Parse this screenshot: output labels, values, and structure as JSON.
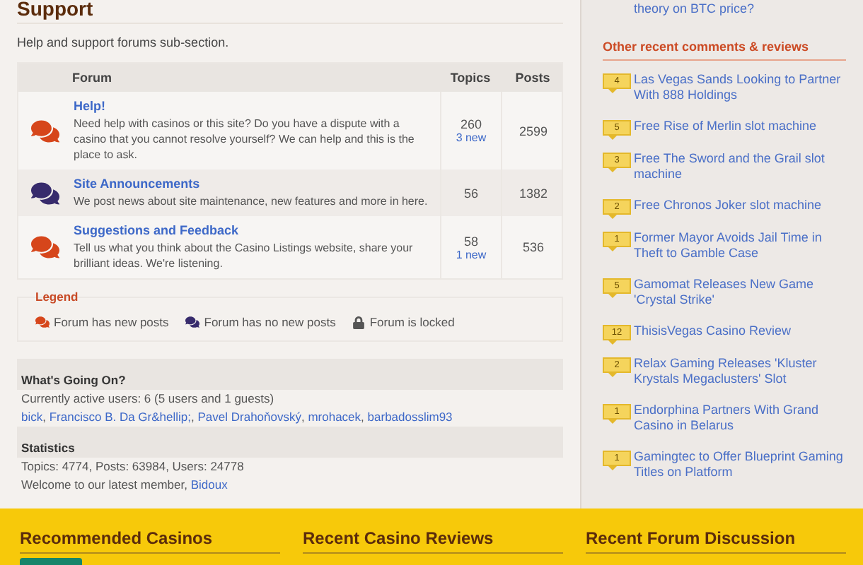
{
  "section": {
    "title": "Support",
    "description": "Help and support forums sub-section."
  },
  "forum_table": {
    "columns": [
      "Forum",
      "Topics",
      "Posts"
    ],
    "rows": [
      {
        "title": "Help!",
        "description": "Need help with casinos or this site? Do you have a dispute with a casino that you cannot resolve yourself? We can help and this is the place to ask.",
        "topics": "260",
        "new_posts": "3 new",
        "posts": "2599",
        "has_new": true
      },
      {
        "title": "Site Announcements",
        "description": "We post news about site maintenance, new features and more in here.",
        "topics": "56",
        "posts": "1382",
        "has_new": false
      },
      {
        "title": "Suggestions and Feedback",
        "description": "Tell us what you think about the Casino Listings website, share your brilliant ideas. We're listening.",
        "topics": "58",
        "new_posts": "1 new",
        "posts": "536",
        "has_new": true
      }
    ]
  },
  "legend": {
    "title": "Legend",
    "items": [
      {
        "kind": "new",
        "label": "Forum has new posts"
      },
      {
        "kind": "no_new",
        "label": "Forum has no new posts"
      },
      {
        "kind": "locked",
        "label": "Forum is locked"
      }
    ]
  },
  "whats_going_on": {
    "title": "What's Going On?",
    "active_users": "Currently active users: 6 (5 users and 1 guests)",
    "separator": ", ",
    "users": [
      "bick",
      "Francisco B. Da Gr&hellip;",
      "Pavel Drahoňovský",
      "mrohacek",
      "barbadosslim93"
    ]
  },
  "statistics": {
    "title": "Statistics",
    "totals": "Topics: 4774, Posts: 63984, Users: 24778",
    "welcome": "Welcome to our latest member, ",
    "latest_member": "Bidoux"
  },
  "sidebar": {
    "top_item": "theory on BTC price?",
    "heading": "Other recent comments & reviews",
    "items": [
      {
        "count": "4",
        "title": "Las Vegas Sands Looking to Partner With 888 Holdings"
      },
      {
        "count": "5",
        "title": "Free Rise of Merlin slot machine"
      },
      {
        "count": "3",
        "title": "Free The Sword and the Grail slot machine"
      },
      {
        "count": "2",
        "title": "Free Chronos Joker slot machine"
      },
      {
        "count": "1",
        "title": "Former Mayor Avoids Jail Time in Theft to Gamble Case"
      },
      {
        "count": "5",
        "title": "Gamomat Releases New Game 'Crystal Strike'"
      },
      {
        "count": "12",
        "title": "ThisisVegas Casino Review"
      },
      {
        "count": "2",
        "title": "Relax Gaming Releases 'Kluster Krystals Megaclusters' Slot"
      },
      {
        "count": "1",
        "title": "Endorphina Partners With Grand Casino in Belarus"
      },
      {
        "count": "1",
        "title": "Gamingtec to Offer Blueprint Gaming Titles on Platform"
      }
    ]
  },
  "footer": {
    "columns": [
      "Recommended Casinos",
      "Recent Casino Reviews",
      "Recent Forum Discussion"
    ]
  }
}
